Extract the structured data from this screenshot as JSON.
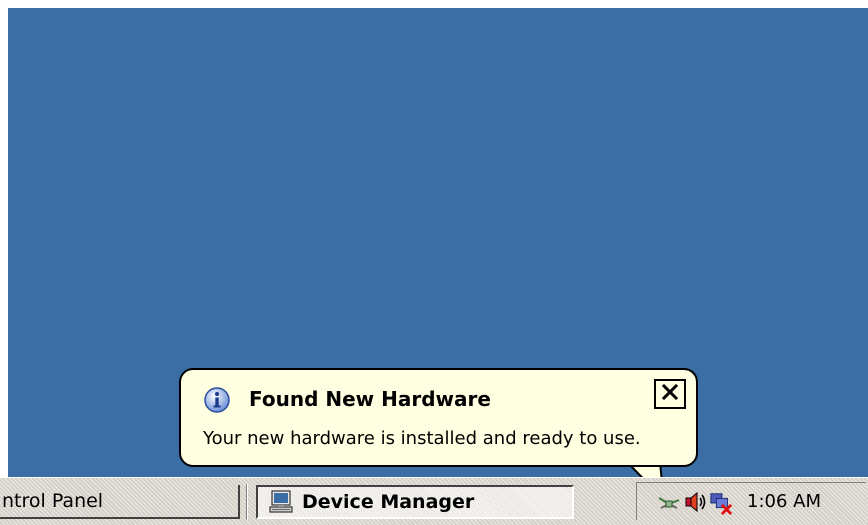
{
  "taskbar": {
    "buttons": [
      {
        "label": "ntrol Panel",
        "active": false
      },
      {
        "label": "Device Manager",
        "active": true,
        "icon": "computer-icon"
      }
    ],
    "tray": {
      "icons": [
        "hardware-icon",
        "volume-icon",
        "network-disconnected-icon"
      ],
      "clock": "1:06 AM"
    }
  },
  "balloon": {
    "icon": "info-icon",
    "title": "Found New Hardware",
    "message": "Your new hardware is installed and ready to use.",
    "close_icon": "close-icon"
  },
  "colors": {
    "desktop": "#3A6EA5",
    "balloon_bg": "#FFFFE1",
    "taskbar": "#D4D0C8"
  }
}
